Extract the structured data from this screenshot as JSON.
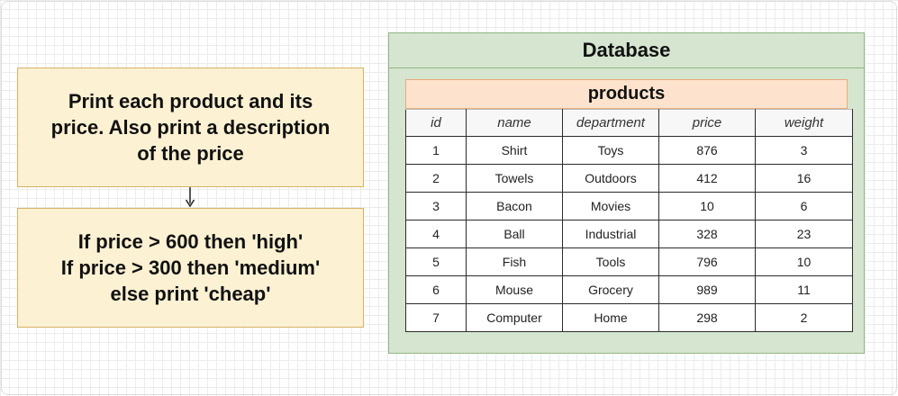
{
  "task_box": {
    "text": "Print each product and its\nprice.  Also print a description\nof the price"
  },
  "rules_box": {
    "text": "If price > 600 then 'high'\nIf price > 300 then 'medium'\nelse print 'cheap'"
  },
  "database": {
    "title": "Database",
    "table": {
      "name": "products",
      "columns": [
        "id",
        "name",
        "department",
        "price",
        "weight"
      ],
      "rows": [
        [
          "1",
          "Shirt",
          "Toys",
          "876",
          "3"
        ],
        [
          "2",
          "Towels",
          "Outdoors",
          "412",
          "16"
        ],
        [
          "3",
          "Bacon",
          "Movies",
          "10",
          "6"
        ],
        [
          "4",
          "Ball",
          "Industrial",
          "328",
          "23"
        ],
        [
          "5",
          "Fish",
          "Tools",
          "796",
          "10"
        ],
        [
          "6",
          "Mouse",
          "Grocery",
          "989",
          "11"
        ],
        [
          "7",
          "Computer",
          "Home",
          "298",
          "2"
        ]
      ]
    }
  },
  "colors": {
    "note_fill": "#fcf1d2",
    "note_border": "#d7b266",
    "db_fill": "#d5e5cf",
    "db_border": "#95b586",
    "table_header_fill": "#fde3cd",
    "table_header_border": "#e7ab7a"
  }
}
